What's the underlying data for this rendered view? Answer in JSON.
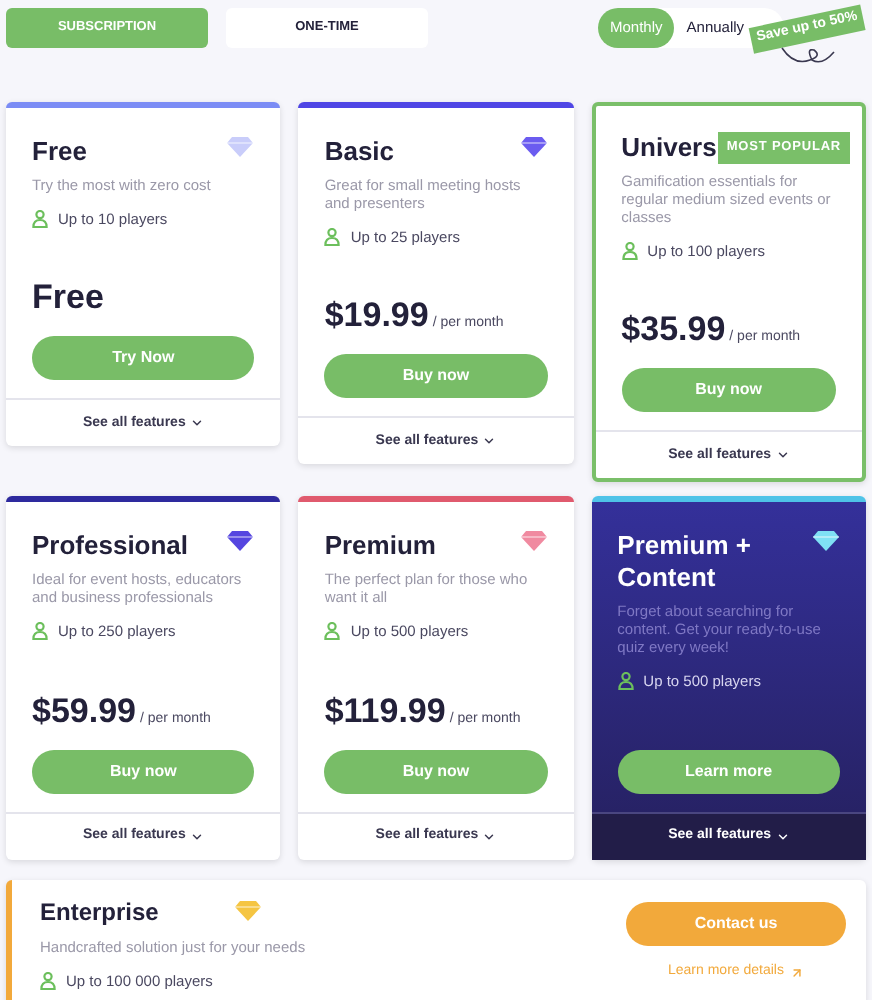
{
  "purchase_tabs": [
    {
      "label": "SUBSCRIPTION",
      "selected": true
    },
    {
      "label": "ONE-TIME",
      "selected": false
    }
  ],
  "billing_toggle": [
    {
      "label": "Monthly",
      "selected": true
    },
    {
      "label": "Annually",
      "selected": false
    }
  ],
  "save_badge": "Save up to 50%",
  "plan_rows": [
    [
      {
        "kind": "standard",
        "title": "Free",
        "color": "#7b8cf5",
        "gem": {
          "color": "#c9cdfa"
        },
        "description": "Try the most with zero cost",
        "players": "Up to 10 players",
        "price": "Free",
        "button": "Try Now",
        "features_link": "See all features"
      },
      {
        "kind": "standard",
        "title": "Basic",
        "color": "#4f46e5",
        "gem": {
          "color": "#6b5cf0"
        },
        "description": "Great for small meeting hosts and presenters",
        "players": "Up to 25 players",
        "price": "$19.99",
        "period": "/ per month",
        "button": "Buy now",
        "features_link": "See all features"
      },
      {
        "kind": "featured",
        "title": "Univers",
        "badge": "MOST POPULAR",
        "color": "#7abf69",
        "description": "Gamification essentials for regular medium sized events or classes",
        "players": "Up to 100 players",
        "price": "$35.99",
        "period": "/ per month",
        "button": "Buy now",
        "features_link": "See all features"
      }
    ],
    [
      {
        "kind": "standard",
        "title": "Professional",
        "color": "#2e2a9e",
        "gem": {
          "color": "#5546e0"
        },
        "description": "Ideal for event hosts, educators and business professionals",
        "players": "Up to 250 players",
        "price": "$59.99",
        "period": "/ per month",
        "button": "Buy now",
        "features_link": "See all features"
      },
      {
        "kind": "standard",
        "title": "Premium",
        "color": "#e05a6e",
        "gem": {
          "color": "#f08aa0"
        },
        "description": "The perfect plan for those who want it all",
        "players": "Up to 500 players",
        "price": "$119.99",
        "period": "/ per month",
        "button": "Buy now",
        "features_link": "See all features"
      },
      {
        "kind": "dark",
        "title": "Premium + Content",
        "color": "#4fc3e8",
        "gem": {
          "color": "#7fe0f5"
        },
        "description": "Forget about searching for content. Get your ready-to-use quiz every week!",
        "players": "Up to 500 players",
        "button": "Learn more",
        "features_link": "See all features"
      }
    ]
  ],
  "enterprise": {
    "title": "Enterprise",
    "gem": {
      "color": "#f5c542"
    },
    "description": "Handcrafted solution just for your needs",
    "players": "Up to 100 000 players",
    "button": "Contact us",
    "link": "Learn more details"
  }
}
